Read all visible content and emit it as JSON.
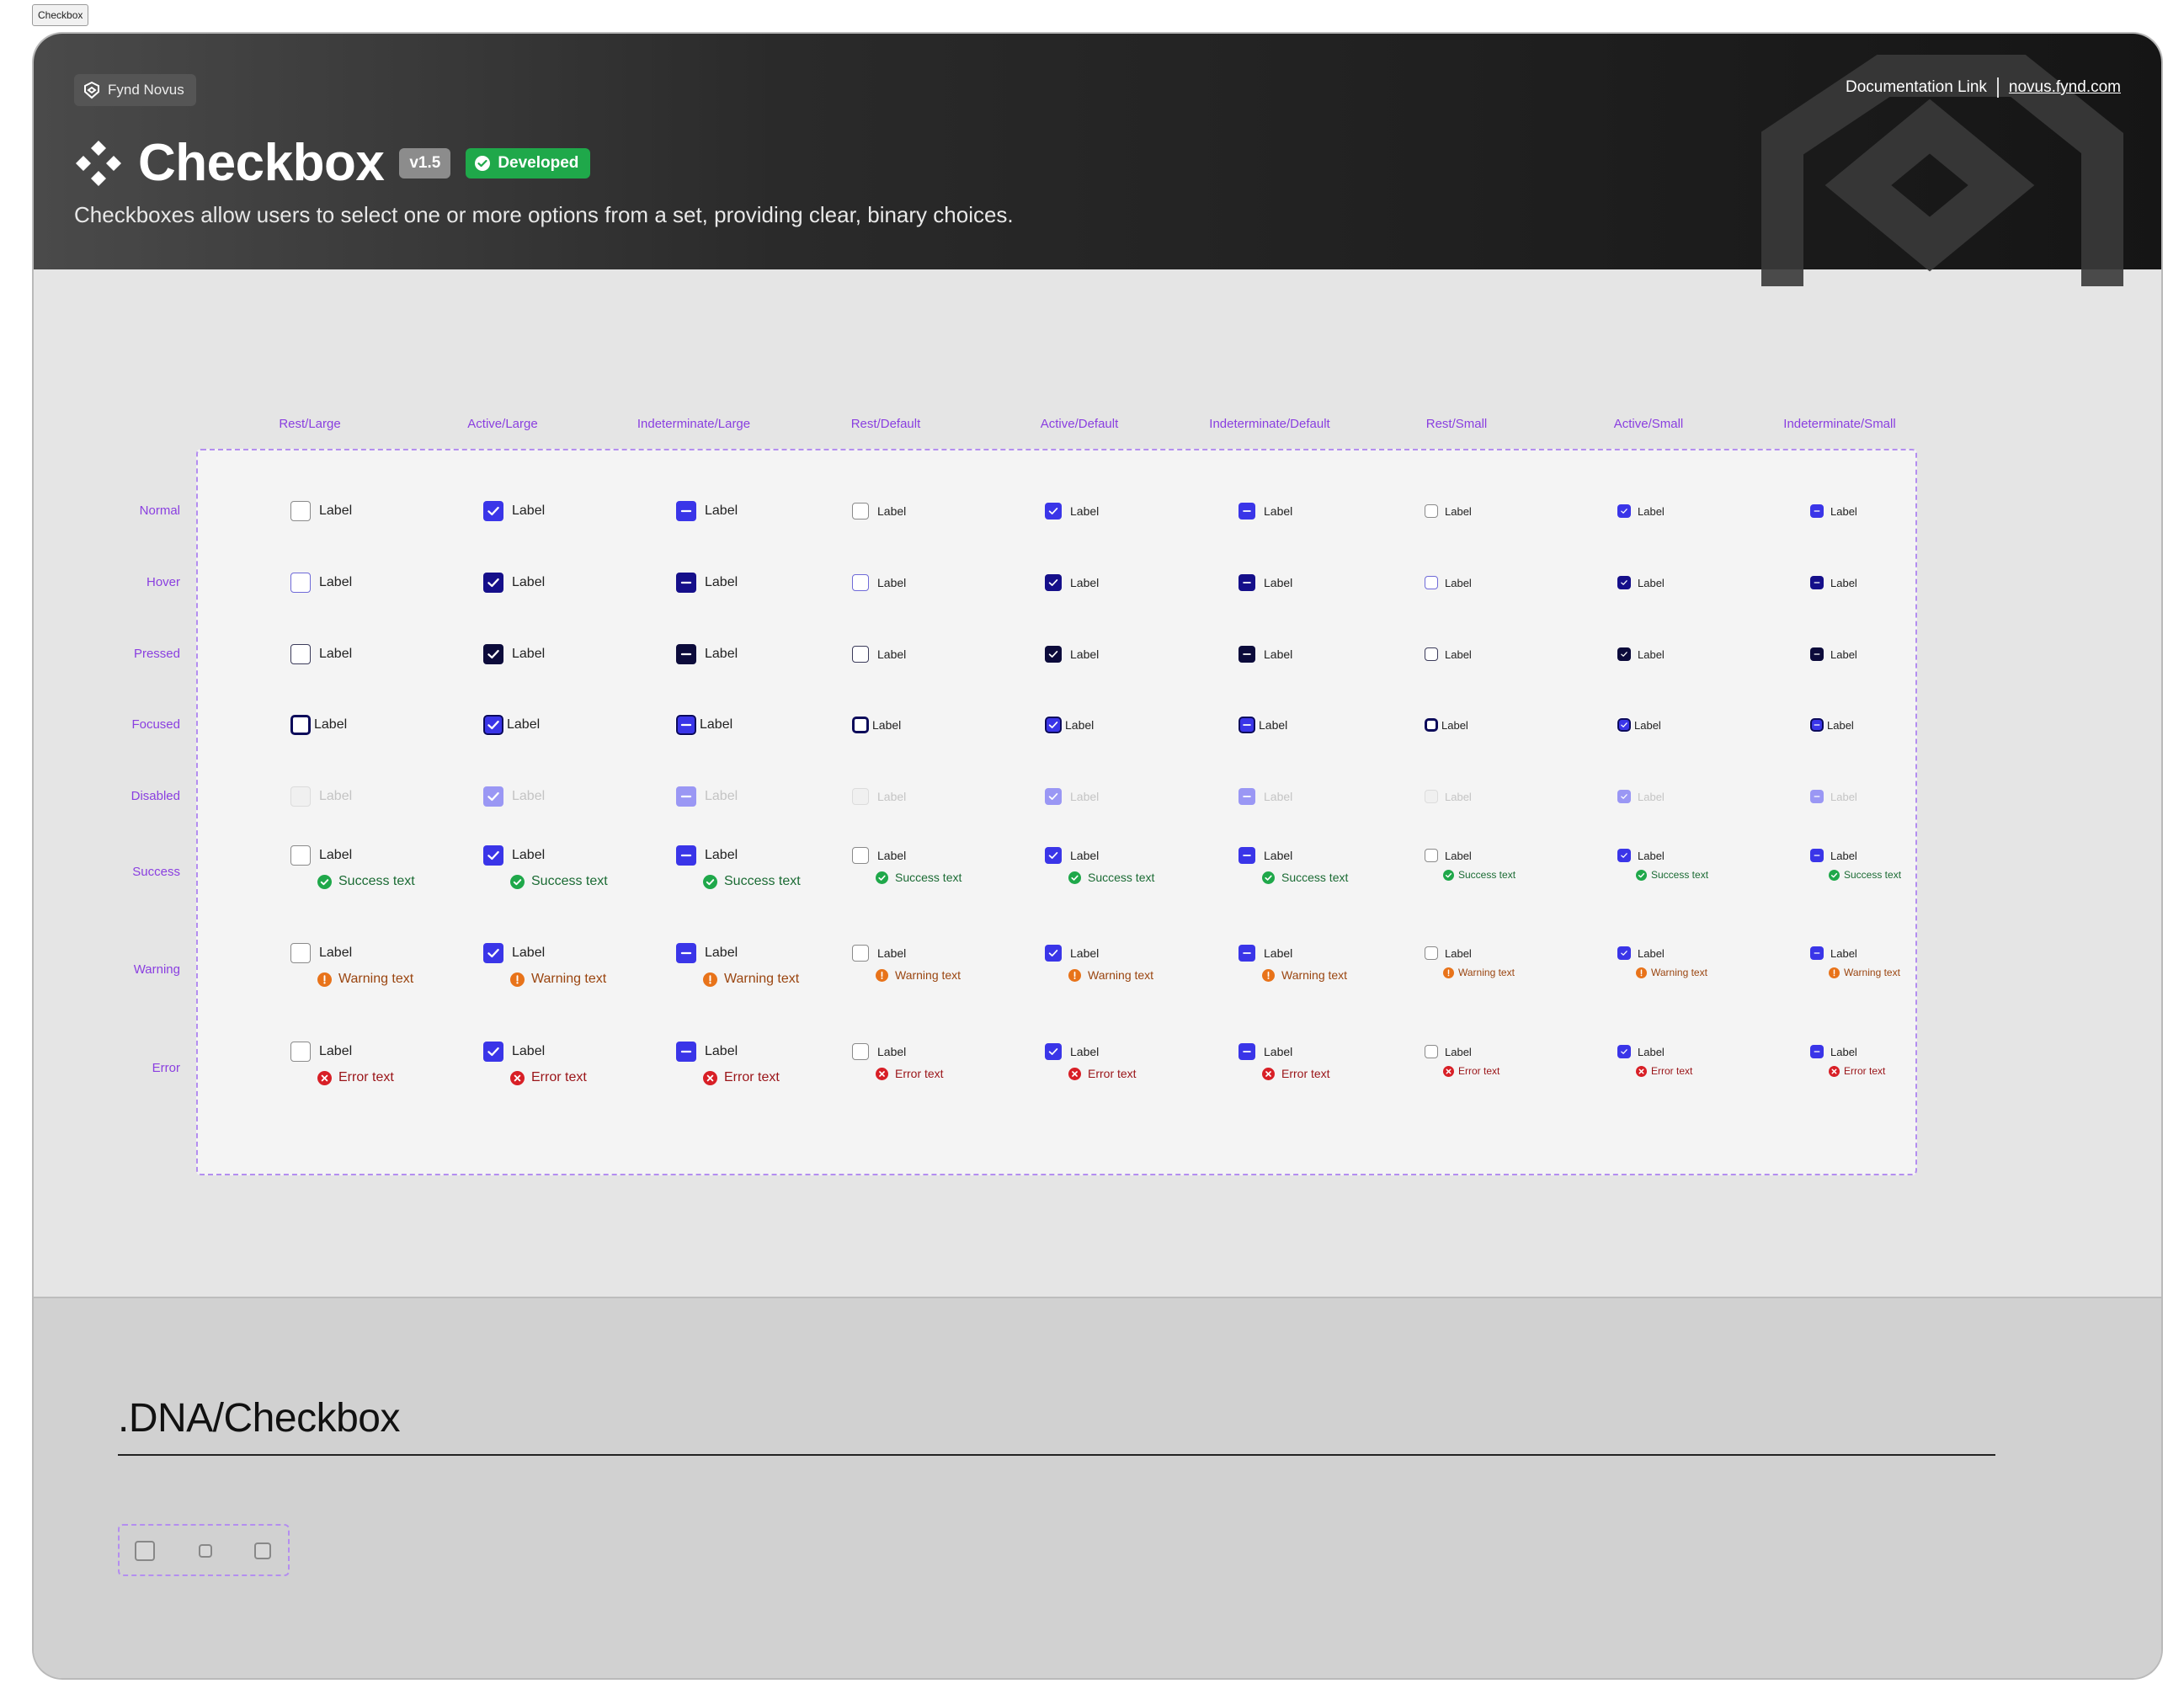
{
  "frame_tag": "Checkbox",
  "header": {
    "brand": "Fynd Novus",
    "doc_link_label": "Documentation Link",
    "doc_link_url": "novus.fynd.com",
    "title": "Checkbox",
    "version": "v1.5",
    "status": "Developed",
    "subtitle": "Checkboxes allow users to select one or more options from a set, providing clear, binary choices."
  },
  "grid": {
    "columns": [
      "Rest/Large",
      "Active/Large",
      "Indeterminate/Large",
      "Rest/Default",
      "Active/Default",
      "Indeterminate/Default",
      "Rest/Small",
      "Active/Small",
      "Indeterminate/Small"
    ],
    "rows": [
      "Normal",
      "Hover",
      "Pressed",
      "Focused",
      "Disabled",
      "Success",
      "Warning",
      "Error"
    ],
    "checkbox_label": "Label",
    "helper_texts": {
      "Success": "Success text",
      "Warning": "Warning text",
      "Error": "Error text"
    }
  },
  "footer": {
    "title": ".DNA/Checkbox"
  },
  "colors": {
    "accent": "#3a35e8",
    "accent_hover": "#150f8a",
    "accent_pressed": "#0c0b3b",
    "disabled_fill": "#9a97f4",
    "label_purple": "#8a3fe0",
    "success": "#1fa84a",
    "warning": "#e8731a",
    "error": "#d81f26",
    "header_bg": "#2a2a2a"
  }
}
